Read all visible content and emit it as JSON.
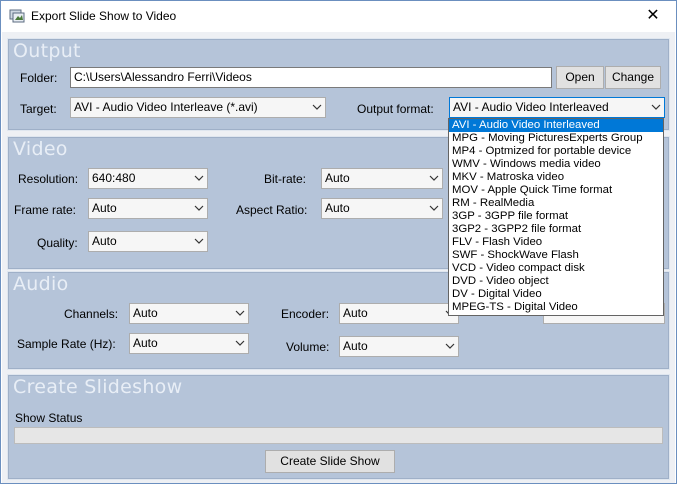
{
  "window": {
    "title": "Export Slide Show to Video",
    "close_glyph": "✕"
  },
  "output": {
    "group_title": "Output",
    "folder_label": "Folder:",
    "folder_value": "C:\\Users\\Alessandro Ferri\\Videos",
    "open_label": "Open",
    "change_label": "Change",
    "target_label": "Target:",
    "target_value": "AVI - Audio Video Interleave (*.avi)",
    "format_label": "Output format:",
    "format_value": "AVI - Audio Video Interleaved",
    "format_options": [
      "AVI - Audio Video Interleaved",
      "MPG - Moving PicturesExperts Group",
      "MP4 - Optmized for portable device",
      "WMV - Windows media video",
      "MKV - Matroska video",
      "MOV - Apple Quick Time format",
      "RM - RealMedia",
      "3GP - 3GPP file format",
      "3GP2 - 3GPP2 file format",
      "FLV - Flash Video",
      "SWF - ShockWave Flash",
      "VCD - Video compact disk",
      "DVD - Video object",
      "DV - Digital Video",
      "MPEG-TS - Digital Video"
    ]
  },
  "video": {
    "group_title": "Video",
    "resolution_label": "Resolution:",
    "resolution_value": "640:480",
    "bitrate_label": "Bit-rate:",
    "bitrate_value": "Auto",
    "framerate_label": "Frame rate:",
    "framerate_value": "Auto",
    "aspect_label": "Aspect Ratio:",
    "aspect_value": "Auto",
    "quality_label": "Quality:",
    "quality_value": "Auto"
  },
  "audio": {
    "group_title": "Audio",
    "channels_label": "Channels:",
    "channels_value": "Auto",
    "encoder_label": "Encoder:",
    "encoder_value": "Auto",
    "samplerate_label": "Sample Rate (Hz):",
    "samplerate_value": "Auto",
    "volume_label": "Volume:",
    "volume_value": "Auto"
  },
  "slideshow": {
    "group_title": "Create Slideshow",
    "status_label": "Show Status",
    "progress": 0,
    "create_label": "Create Slide Show"
  },
  "colors": {
    "group_bg": "#b5c4d9",
    "accent": "#0078d7"
  },
  "icons": {
    "app": "slideshow-app-icon",
    "close": "close-icon",
    "dropdown_arrow": "chevron-down-icon"
  }
}
